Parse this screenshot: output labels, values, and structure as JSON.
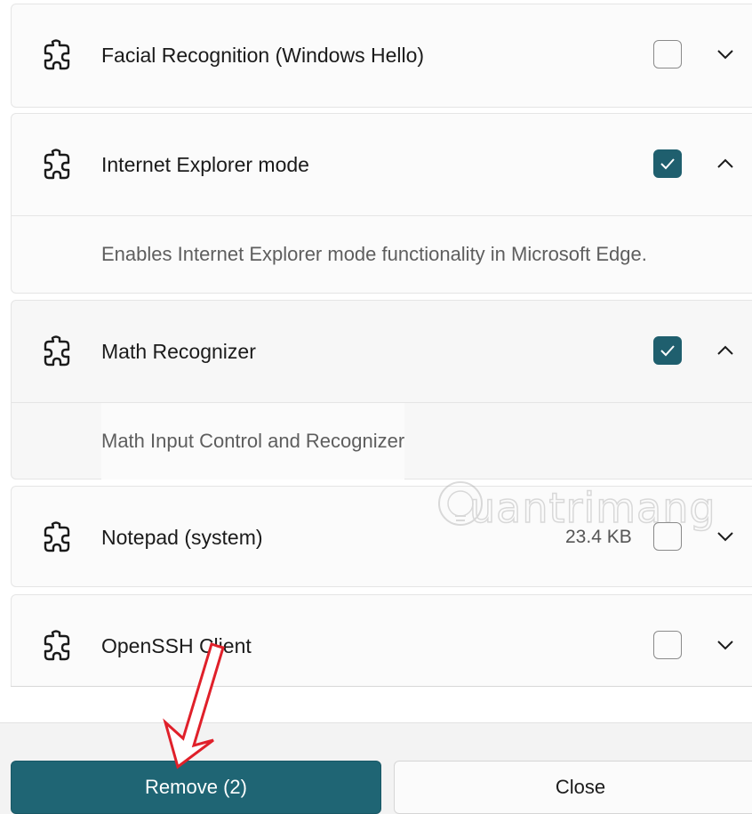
{
  "features": [
    {
      "name": "Facial Recognition (Windows Hello)",
      "checked": false,
      "expanded": false,
      "size": "",
      "icon": "puzzle-icon"
    },
    {
      "name": "Internet Explorer mode",
      "checked": true,
      "expanded": true,
      "size": "",
      "description": "Enables Internet Explorer mode functionality in Microsoft Edge.",
      "icon": "puzzle-icon"
    },
    {
      "name": "Math Recognizer",
      "checked": true,
      "expanded": true,
      "size": "",
      "description": "Math Input Control and Recognizer",
      "icon": "puzzle-icon"
    },
    {
      "name": "Notepad (system)",
      "checked": false,
      "expanded": false,
      "size": "23.4 KB",
      "icon": "puzzle-icon"
    },
    {
      "name": "OpenSSH Client",
      "checked": false,
      "expanded": false,
      "size": "",
      "icon": "puzzle-icon"
    }
  ],
  "footer": {
    "remove_label": "Remove (2)",
    "close_label": "Close"
  },
  "watermark": {
    "text": "uantrimang"
  },
  "colors": {
    "accent": "#1f6574",
    "checked": "#1f5f6e",
    "annotation_arrow": "#e0202a"
  }
}
